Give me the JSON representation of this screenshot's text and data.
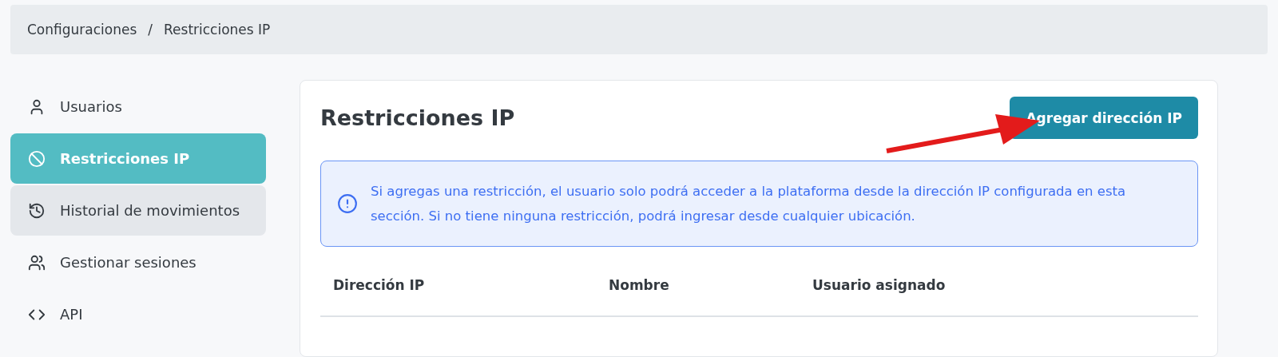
{
  "breadcrumb": [
    {
      "label": "Configuraciones"
    },
    {
      "label": "Restricciones IP"
    }
  ],
  "breadcrumb_separator": "/",
  "sidebar": {
    "items": [
      {
        "label": "Usuarios",
        "selected": false,
        "hovered": false
      },
      {
        "label": "Restricciones IP",
        "selected": true,
        "hovered": false
      },
      {
        "label": "Historial de movimientos",
        "selected": false,
        "hovered": true
      },
      {
        "label": "Gestionar sesiones",
        "selected": false,
        "hovered": false
      },
      {
        "label": "API",
        "selected": false,
        "hovered": false
      }
    ]
  },
  "panel": {
    "title": "Restricciones IP",
    "add_button": "Agregar dirección IP",
    "alert": "Si agregas una restricción, el usuario solo podrá acceder a la plataforma desde la dirección IP configurada en esta sección. Si no tiene ninguna restricción, podrá ingresar desde cualquier ubicación.",
    "table": {
      "columns": [
        "Dirección IP",
        "Nombre",
        "Usuario asignado"
      ]
    }
  }
}
